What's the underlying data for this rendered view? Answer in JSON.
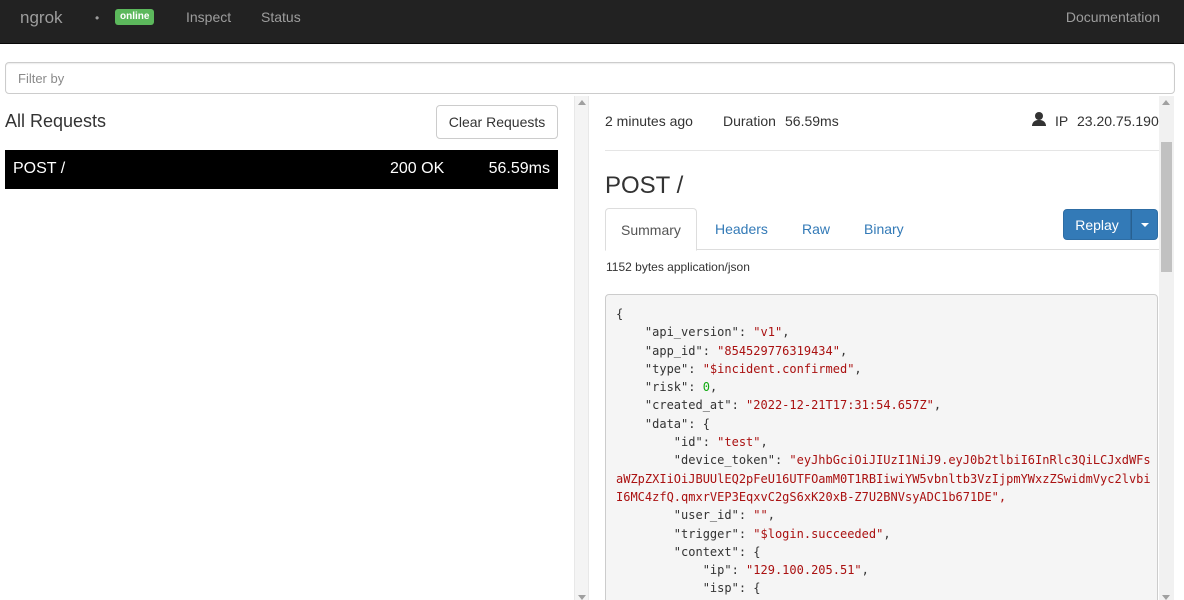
{
  "navbar": {
    "brand": "ngrok",
    "dot": "•",
    "status_badge": "online",
    "links": {
      "inspect": "Inspect",
      "status": "Status",
      "documentation": "Documentation"
    }
  },
  "filter": {
    "placeholder": "Filter by",
    "value": ""
  },
  "requests": {
    "title": "All Requests",
    "clear_label": "Clear Requests",
    "items": [
      {
        "method_path": "POST /",
        "status": "200 OK",
        "duration": "56.59ms"
      }
    ]
  },
  "detail": {
    "time_ago": "2 minutes ago",
    "duration_label": "Duration",
    "duration_value": "56.59ms",
    "ip_label": "IP",
    "ip_value": "23.20.75.190",
    "title": "POST /",
    "tabs": {
      "summary": "Summary",
      "headers": "Headers",
      "raw": "Raw",
      "binary": "Binary"
    },
    "replay_label": "Replay",
    "body_meta": "1152 bytes application/json",
    "body_lines": [
      "{",
      "    \"api_version\": \"v1\",",
      "    \"app_id\": \"854529776319434\",",
      "    \"type\": \"$incident.confirmed\",",
      "    \"risk\": 0,",
      "    \"created_at\": \"2022-12-21T17:31:54.657Z\",",
      "    \"data\": {",
      "        \"id\": \"test\",",
      "        \"device_token\": \"eyJhbGciOiJIUzI1NiJ9.eyJ0b2tlbiI6InRlc3QiLCJxdWFs",
      "aWZpZXIiOiJBUUlEQ2pFeU16UTFOamM0T1RBIiwiYW5vbnltb3VzIjpmYWxzZSwidmVyc2lvbi",
      "I6MC4zfQ.qmxrVEP3EqxvC2gS6xK20xB-Z7U2BNVsyADC1b671DE\",",
      "        \"user_id\": \"\",",
      "        \"trigger\": \"$login.succeeded\",",
      "        \"context\": {",
      "            \"ip\": \"129.100.205.51\",",
      "            \"isp\": {"
    ]
  },
  "colors": {
    "navbar_bg": "#222222",
    "online_badge": "#5cb85c",
    "replay_button": "#337ab7",
    "string": "#aa1111",
    "number": "#11aa11"
  }
}
